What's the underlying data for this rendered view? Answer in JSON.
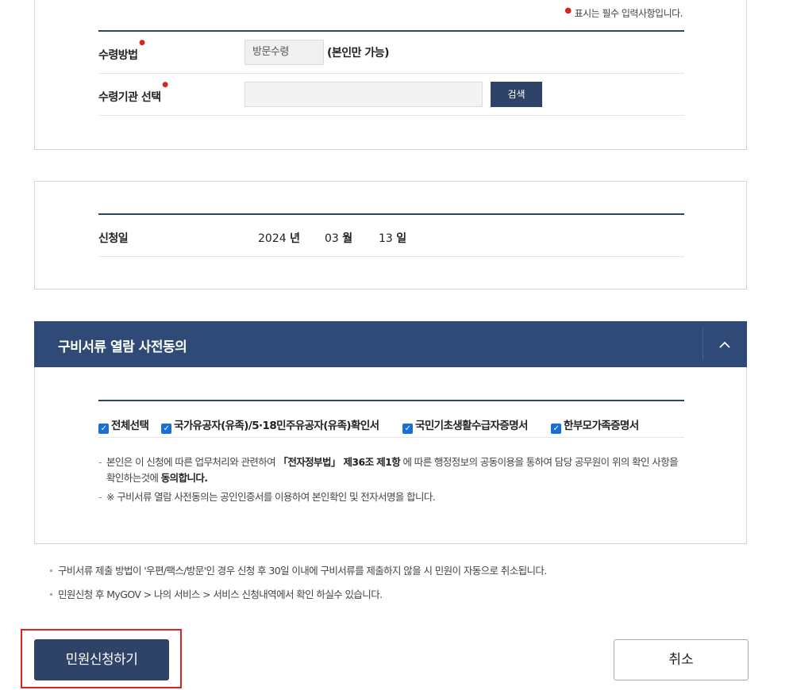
{
  "receipt": {
    "required_note": "표시는 필수 입력사항입니다.",
    "method_label": "수령방법",
    "method_value": "방문수령",
    "method_suffix": "(본인만 가능)",
    "institution_label": "수령기관 선택",
    "institution_value": "",
    "search_button": "검색"
  },
  "application": {
    "date_label": "신청일",
    "year": "2024",
    "year_unit": "년",
    "month": "03",
    "month_unit": "월",
    "day": "13",
    "day_unit": "일"
  },
  "consent": {
    "title": "구비서류 열람 사전동의",
    "toggle_icon": "chevron-up",
    "checkboxes": [
      {
        "label": "전체선택",
        "checked": true
      },
      {
        "label": "국가유공자(유족)/5·18민주유공자(유족)확인서",
        "checked": true
      },
      {
        "label": "국민기초생활수급자증명서",
        "checked": true
      },
      {
        "label": "한부모가족증명서",
        "checked": true
      }
    ],
    "note1_pre": "본인은 이 신청에 따른 업무처리와 관련하여 ",
    "note1_law": "「전자정부법」 제36조 제1항",
    "note1_mid": " 에 따른 행정정보의 공동이용을 통하여 담당 공무원이 위의 확인 사항을 확인하는것에 ",
    "note1_end": "동의합니다.",
    "note2": "※ 구비서류 열람 사전동의는 공인인증서를 이용하여 본인확인 및 전자서명을 합니다."
  },
  "bottom_notes": [
    "구비서류 제출 방법이 '우편/팩스/방문'인 경우 신청 후 30일 이내에 구비서류를 제출하지 않을 시 민원이 자동으로 취소됩니다.",
    "민원신청 후 MyGOV > 나의 서비스 > 서비스 신청내역에서 확인 하실수 있습니다."
  ],
  "actions": {
    "submit": "민원신청하기",
    "cancel": "취소"
  },
  "colors": {
    "primary": "#2f4267",
    "accordion": "#2f4a76",
    "required": "#d9261c",
    "highlight_outline": "#e0221b",
    "checkbox": "#1a6fd4"
  }
}
